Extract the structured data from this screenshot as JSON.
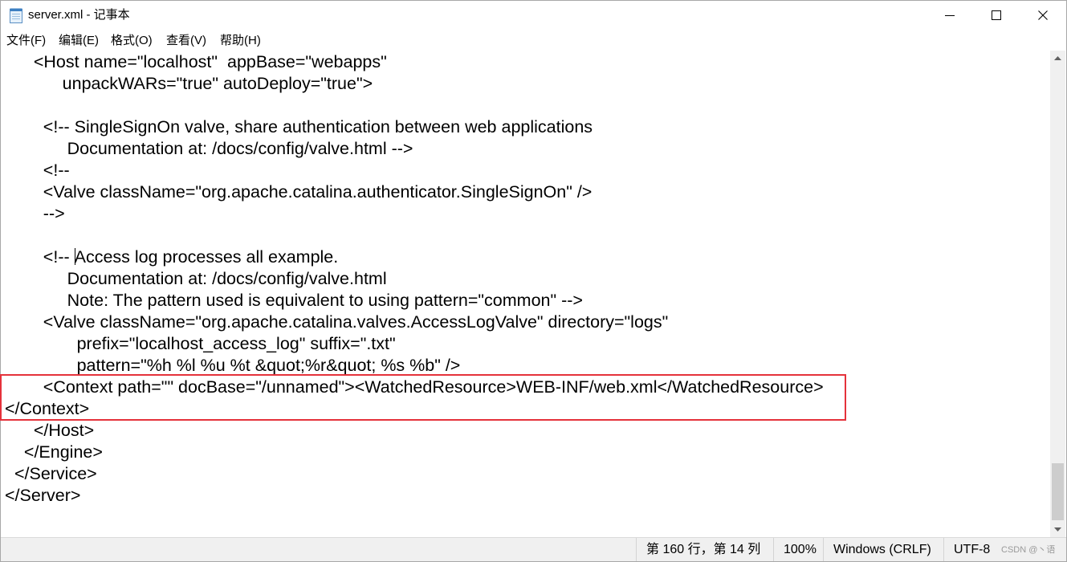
{
  "window": {
    "title": "server.xml - 记事本"
  },
  "menu": {
    "items": [
      "文件(F)",
      "编辑(E)",
      "格式(O)",
      "查看(V)",
      "帮助(H)"
    ]
  },
  "editor": {
    "lines": [
      "      <Host name=\"localhost\"  appBase=\"webapps\"",
      "            unpackWARs=\"true\" autoDeploy=\"true\">",
      "",
      "        <!-- SingleSignOn valve, share authentication between web applications",
      "             Documentation at: /docs/config/valve.html -->",
      "        <!--",
      "        <Valve className=\"org.apache.catalina.authenticator.SingleSignOn\" />",
      "        -->",
      "",
      "        <!-- Access log processes all example.",
      "             Documentation at: /docs/config/valve.html",
      "             Note: The pattern used is equivalent to using pattern=\"common\" -->",
      "        <Valve className=\"org.apache.catalina.valves.AccessLogValve\" directory=\"logs\"",
      "               prefix=\"localhost_access_log\" suffix=\".txt\"",
      "               pattern=\"%h %l %u %t &quot;%r&quot; %s %b\" />",
      "        <Context path=\"\" docBase=\"/unnamed\"><WatchedResource>WEB-INF/web.xml</WatchedResource>",
      "</Context>",
      "      </Host>",
      "    </Engine>",
      "  </Service>",
      "</Server>"
    ]
  },
  "scroll": {
    "scrolled_pct": 99.6,
    "visible_pct": 12.5
  },
  "status_bar": {
    "cursor_position": "第 160 行，第 14 列",
    "zoom": "100%",
    "line_ending": "Windows (CRLF)",
    "encoding": "UTF-8"
  },
  "watermark": "CSDN @丶语",
  "icons": {
    "app": "notepad-icon",
    "minimize": "minimize-icon",
    "maximize": "maximize-icon",
    "close": "close-icon",
    "scroll_up": "scroll-up-icon",
    "scroll_down": "scroll-down-icon"
  },
  "colors": {
    "highlight_box": "#e5323b",
    "editor_background": "#ffffff",
    "chrome_background": "#f0f0f0",
    "scrollbar_thumb": "#cdcdcd"
  }
}
